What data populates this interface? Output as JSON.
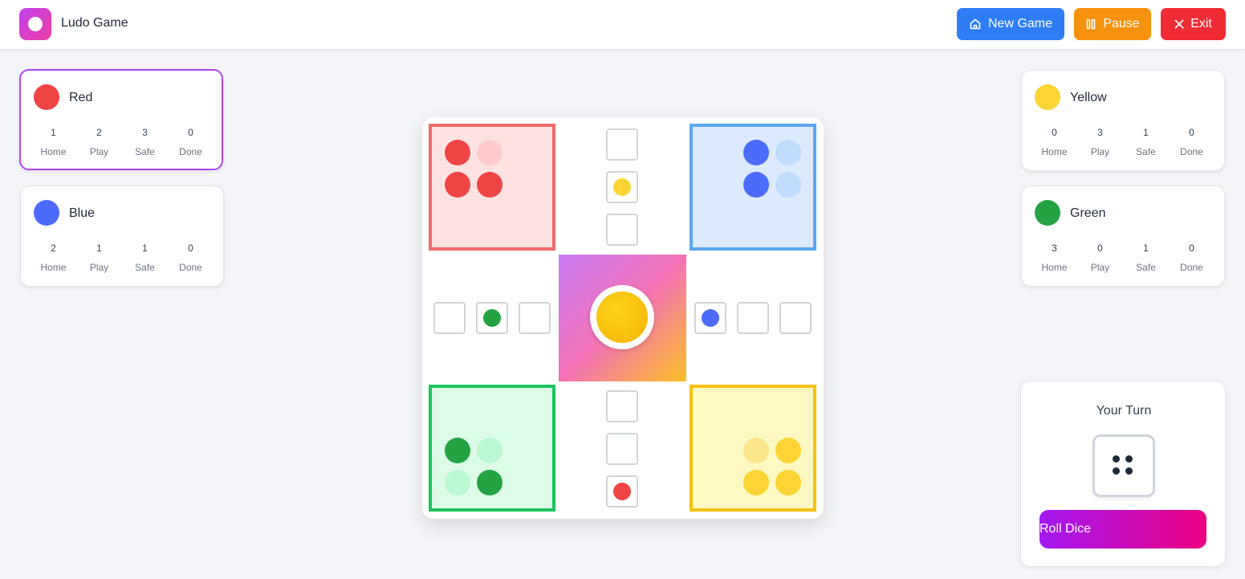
{
  "app": {
    "title": "Ludo Game",
    "logo_icon": "ludo-logo-icon"
  },
  "header": {
    "new_game_label": "New Game",
    "new_game_icon": "home-icon",
    "pause_label": "Pause",
    "pause_icon": "pause-icon",
    "exit_label": "Exit",
    "exit_icon": "close-icon"
  },
  "stat_labels": [
    "Home",
    "Play",
    "Safe",
    "Done"
  ],
  "players": {
    "red": {
      "name": "Red",
      "color": "#ef4444",
      "active": true,
      "stats": [
        "1",
        "2",
        "3",
        "0"
      ]
    },
    "blue": {
      "name": "Blue",
      "color": "#4d6bfa",
      "active": false,
      "stats": [
        "2",
        "1",
        "1",
        "0"
      ]
    },
    "yellow": {
      "name": "Yellow",
      "color": "#fcd535",
      "active": false,
      "stats": [
        "0",
        "3",
        "1",
        "0"
      ]
    },
    "green": {
      "name": "Green",
      "color": "#23a343",
      "active": false,
      "stats": [
        "3",
        "0",
        "1",
        "0"
      ]
    }
  },
  "turn": {
    "label": "Your Turn",
    "dice_value": 4,
    "roll_label": "Roll Dice"
  }
}
